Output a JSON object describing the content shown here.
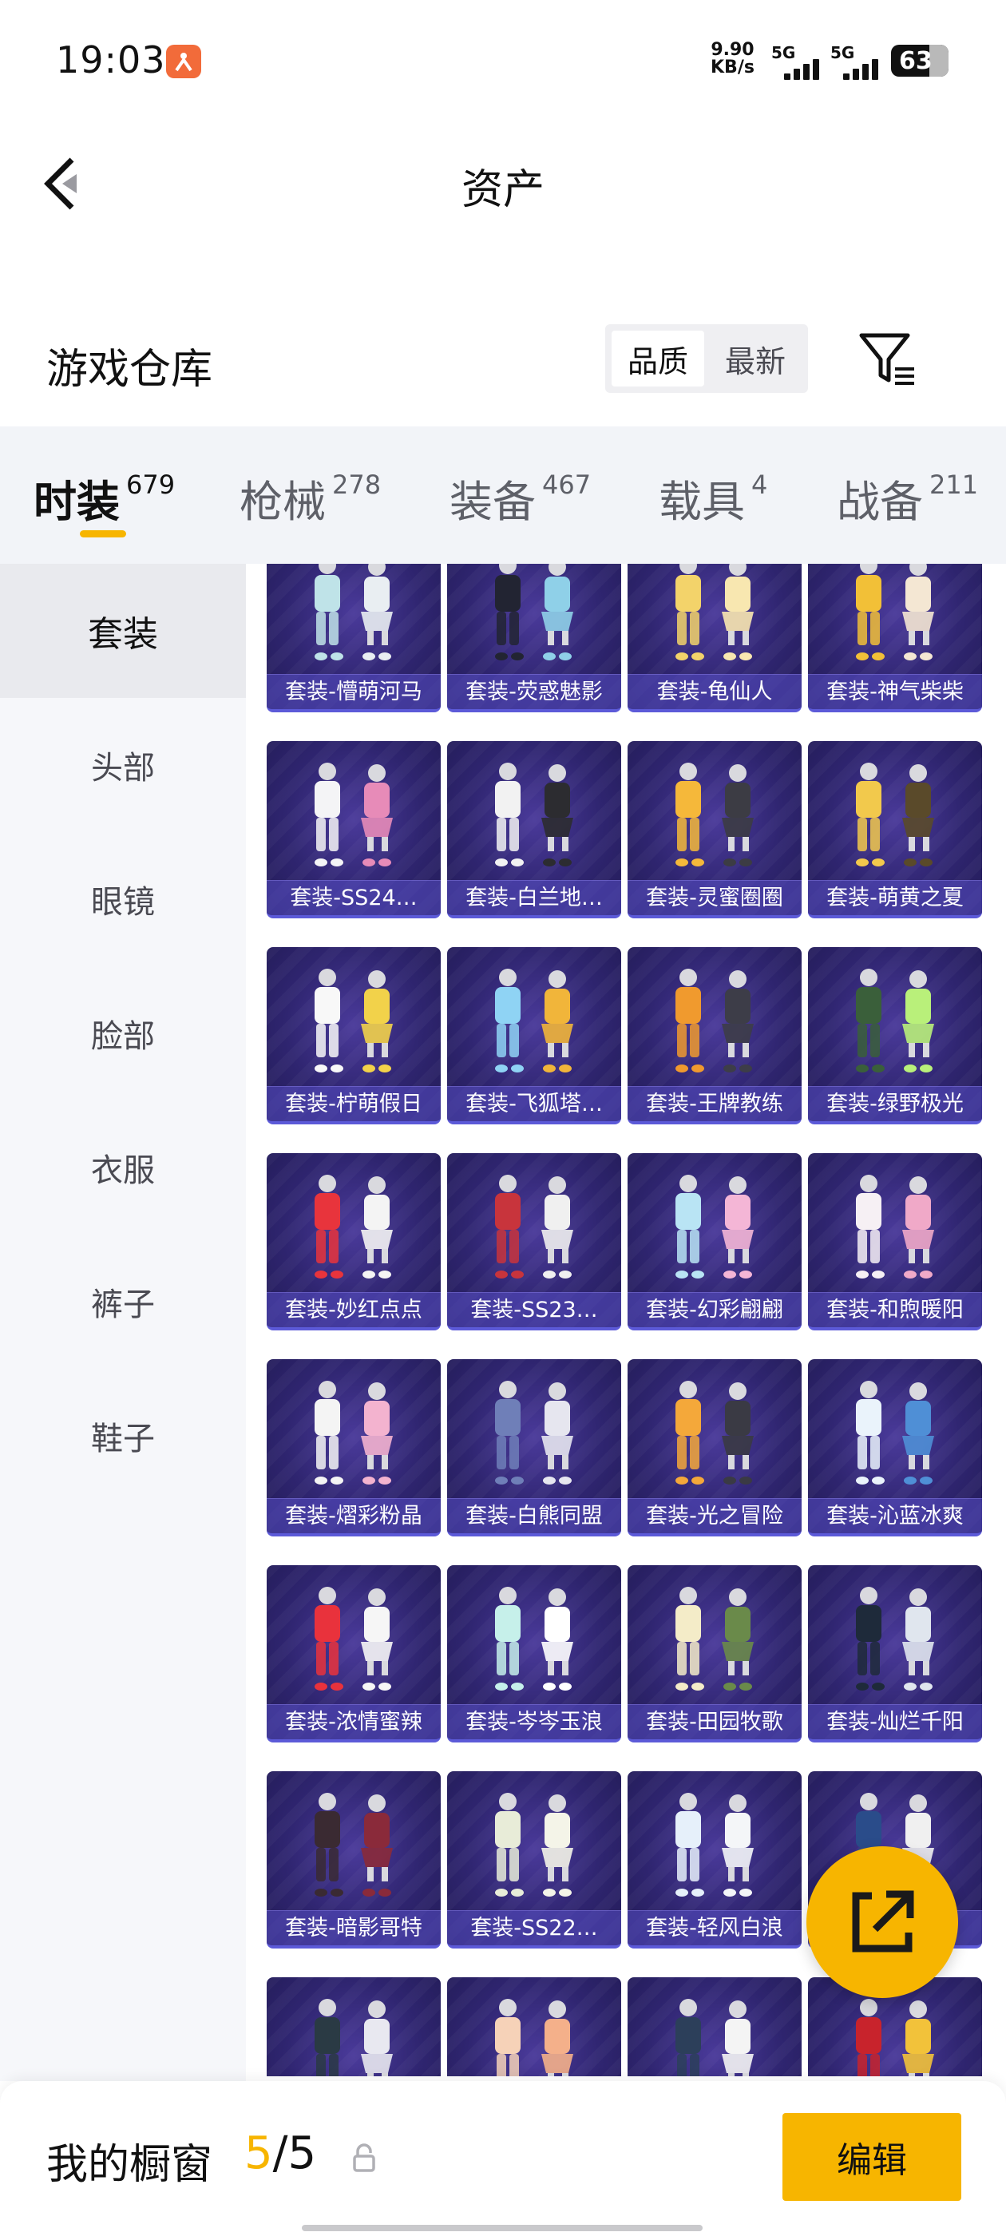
{
  "status_bar": {
    "time": "19:03",
    "notification_icon": "orange-app-notification-icon",
    "net_speed_value": "9.90",
    "net_speed_unit": "KB/s",
    "signal1_label": "5G",
    "signal2_label": "5G",
    "battery_level": "63"
  },
  "header": {
    "back_icon": "chevron-left-icon",
    "title": "资产"
  },
  "section": {
    "title": "游戏仓库",
    "sort_options": [
      "品质",
      "最新"
    ],
    "sort_selected": "品质",
    "filter_icon": "funnel-filter-icon"
  },
  "tabs": [
    {
      "label": "时装",
      "count": "679",
      "active": true
    },
    {
      "label": "枪械",
      "count": "278",
      "active": false
    },
    {
      "label": "装备",
      "count": "467",
      "active": false
    },
    {
      "label": "载具",
      "count": "4",
      "active": false
    },
    {
      "label": "战备",
      "count": "211",
      "active": false
    }
  ],
  "sidebar": {
    "items": [
      {
        "label": "套装",
        "active": true
      },
      {
        "label": "头部",
        "active": false
      },
      {
        "label": "眼镜",
        "active": false
      },
      {
        "label": "脸部",
        "active": false
      },
      {
        "label": "衣服",
        "active": false
      },
      {
        "label": "裤子",
        "active": false
      },
      {
        "label": "鞋子",
        "active": false
      }
    ]
  },
  "items": [
    "套装-懵萌河马",
    "套装-荧惑魅影",
    "套装-龟仙人",
    "套装-神气柴柴",
    "套装-SS24…",
    "套装-白兰地…",
    "套装-灵蜜圈圈",
    "套装-萌黄之夏",
    "套装-柠萌假日",
    "套装-飞狐塔…",
    "套装-王牌教练",
    "套装-绿野极光",
    "套装-妙红点点",
    "套装-SS23…",
    "套装-幻彩翩翩",
    "套装-和煦暖阳",
    "套装-熠彩粉晶",
    "套装-白熊同盟",
    "套装-光之冒险",
    "套装-沁蓝冰爽",
    "套装-浓情蜜辣",
    "套装-岑岑玉浪",
    "套装-田园牧歌",
    "套装-灿烂千阳",
    "套装-暗影哥特",
    "套装-SS22…",
    "套装-轻风白浪",
    "阳",
    "",
    "",
    "",
    ""
  ],
  "share_button_icon": "share-external-icon",
  "bottom_bar": {
    "showcase_label": "我的橱窗",
    "showcase_current": "5",
    "showcase_total": "/5",
    "lock_icon": "lock-icon",
    "edit_label": "编辑"
  },
  "colors": {
    "accent": "#f7b500",
    "card_bg": "#2f2570",
    "card_label_bg": "#584ec8",
    "tab_bar_bg": "#f2f4f8",
    "sidebar_active_bg": "#e9eaee"
  }
}
